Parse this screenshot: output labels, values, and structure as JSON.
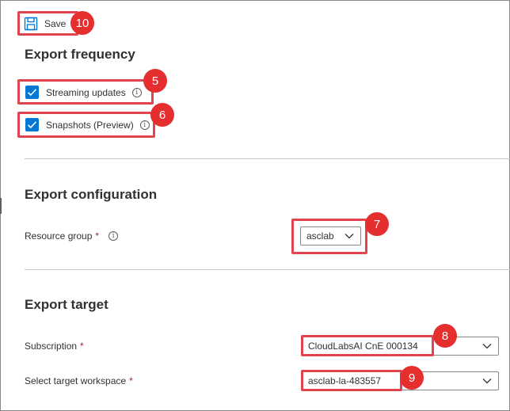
{
  "toolbar": {
    "save_label": "Save",
    "save_icon": "save-icon"
  },
  "sections": {
    "frequency": {
      "title": "Export frequency",
      "streaming_label": "Streaming updates",
      "snapshots_label": "Snapshots (Preview)",
      "streaming_checked": true,
      "snapshots_checked": true
    },
    "configuration": {
      "title": "Export configuration",
      "resource_group_label": "Resource group",
      "resource_group_value": "asclab"
    },
    "target": {
      "title": "Export target",
      "subscription_label": "Subscription",
      "subscription_value": "CloudLabsAI CnE 000134",
      "workspace_label": "Select target workspace",
      "workspace_value": "asclab-la-483557"
    }
  },
  "required_marker": "*",
  "info_glyph": "i",
  "callouts": [
    "10",
    "5",
    "6",
    "7",
    "8",
    "9"
  ],
  "colors": {
    "accent": "#0078d4",
    "callout": "#e52e2e",
    "highlight": "#e0454f",
    "required": "#a4262c"
  }
}
